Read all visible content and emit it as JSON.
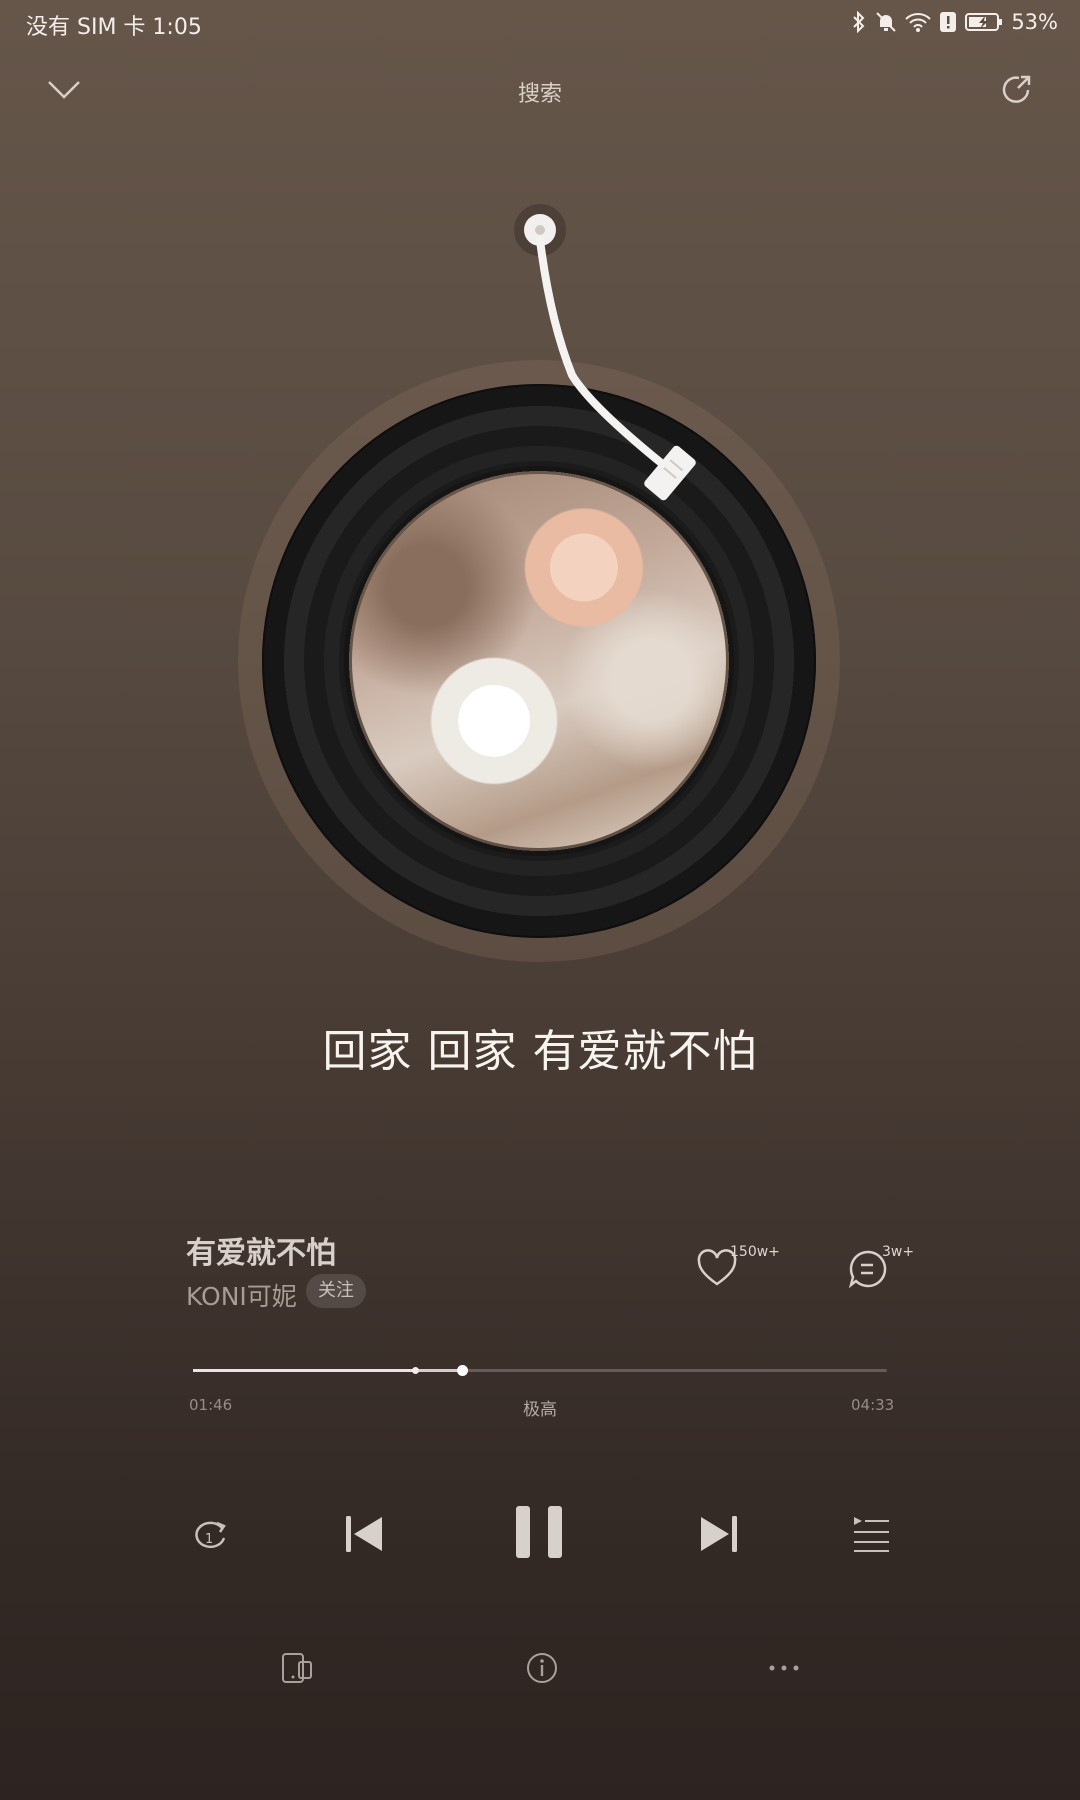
{
  "status_bar": {
    "carrier_time": "没有 SIM 卡 1:05",
    "battery": "53%",
    "icons": [
      "bluetooth-icon",
      "mute-icon",
      "wifi-icon",
      "alert-icon",
      "battery-charging-icon"
    ]
  },
  "header": {
    "title": "搜索",
    "left_icon": "chevron-down-icon",
    "right_icon": "share-icon"
  },
  "lyric": "回家 回家 有爱就不怕",
  "song": {
    "title": "有爱就不怕",
    "artist": "KONI可妮",
    "follow_label": "关注",
    "like_count": "150w+",
    "comment_count": "3w+"
  },
  "progress": {
    "current": "01:46",
    "total": "04:33",
    "quality": "极高",
    "played_fraction": 0.388,
    "buffered_fraction": 0.32
  },
  "controls": [
    "repeat-one-icon",
    "previous-icon",
    "pause-icon",
    "next-icon",
    "playlist-icon"
  ],
  "bottom_actions": [
    "device-icon",
    "info-icon",
    "more-icon"
  ],
  "colors": {
    "accent": "#ffffff",
    "background_top": "#66564a",
    "background_bottom": "#2d2421"
  }
}
